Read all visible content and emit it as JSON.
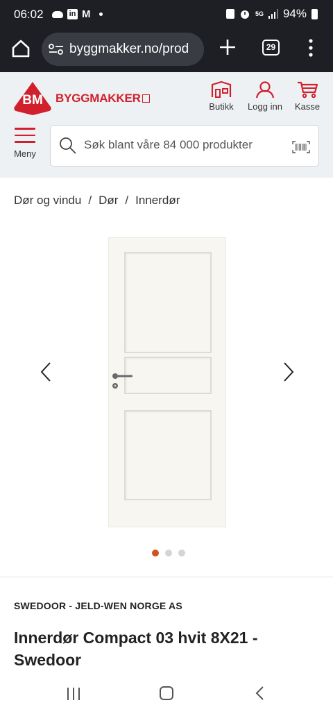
{
  "status_bar": {
    "time": "06:02",
    "linkedin": "in",
    "mail": "M",
    "network": "5G",
    "battery": "94%"
  },
  "browser": {
    "url": "byggmakker.no/prod",
    "tab_count": "29"
  },
  "header": {
    "logo_badge": "BM",
    "logo_word": "BYGGMAKKER",
    "actions": [
      {
        "label": "Butikk",
        "icon": "store-icon"
      },
      {
        "label": "Logg inn",
        "icon": "user-icon"
      },
      {
        "label": "Kasse",
        "icon": "cart-icon"
      }
    ],
    "menu_label": "Meny"
  },
  "search": {
    "placeholder": "Søk blant våre 84 000 produkter"
  },
  "breadcrumb": [
    "Dør og vindu",
    "Dør",
    "Innerdør"
  ],
  "gallery": {
    "image_count": 3,
    "active_index": 0
  },
  "product": {
    "brand": "SWEDOOR - JELD-WEN NORGE AS",
    "title": "Innerdør Compact 03 hvit 8X21 - Swedoor"
  },
  "colors": {
    "brand_red": "#d11f2c",
    "active_dot": "#d0541f",
    "header_bg": "#eef1f3",
    "dark_chrome": "#1d1f24"
  }
}
